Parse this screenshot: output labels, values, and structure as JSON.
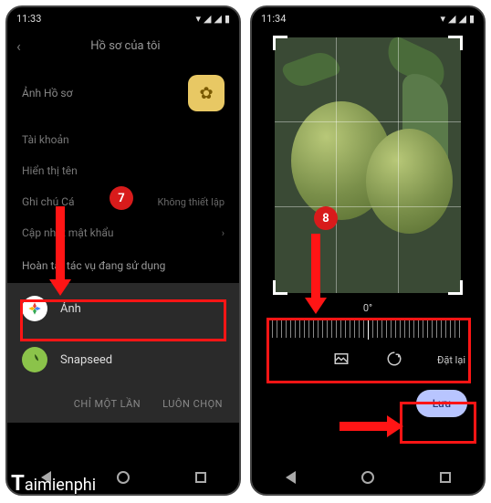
{
  "left": {
    "status_time": "11:33",
    "header_title": "Hồ sơ của tôi",
    "avatar_label": "Ảnh Hồ sơ",
    "rows": {
      "account": "Tài khoản",
      "display_name": "Hiển thị tên",
      "personal_note": "Ghi chú Cá",
      "personal_note_val": "Không thiết lập",
      "update_password": "Cập nhật mật khẩu"
    },
    "sheet_header": "Hoàn tất tác vụ đang sử dụng",
    "sheet_items": {
      "photos": "Ảnh",
      "snapseed": "Snapseed"
    },
    "sheet_footer": {
      "once": "CHỈ MỘT LẦN",
      "always": "LUÔN CHỌN"
    }
  },
  "right": {
    "status_time": "11:34",
    "angle": "0°",
    "reset": "Đặt lại",
    "save": "Lưu"
  },
  "badges": {
    "b7": "7",
    "b8": "8"
  },
  "watermark": "aimienphi"
}
